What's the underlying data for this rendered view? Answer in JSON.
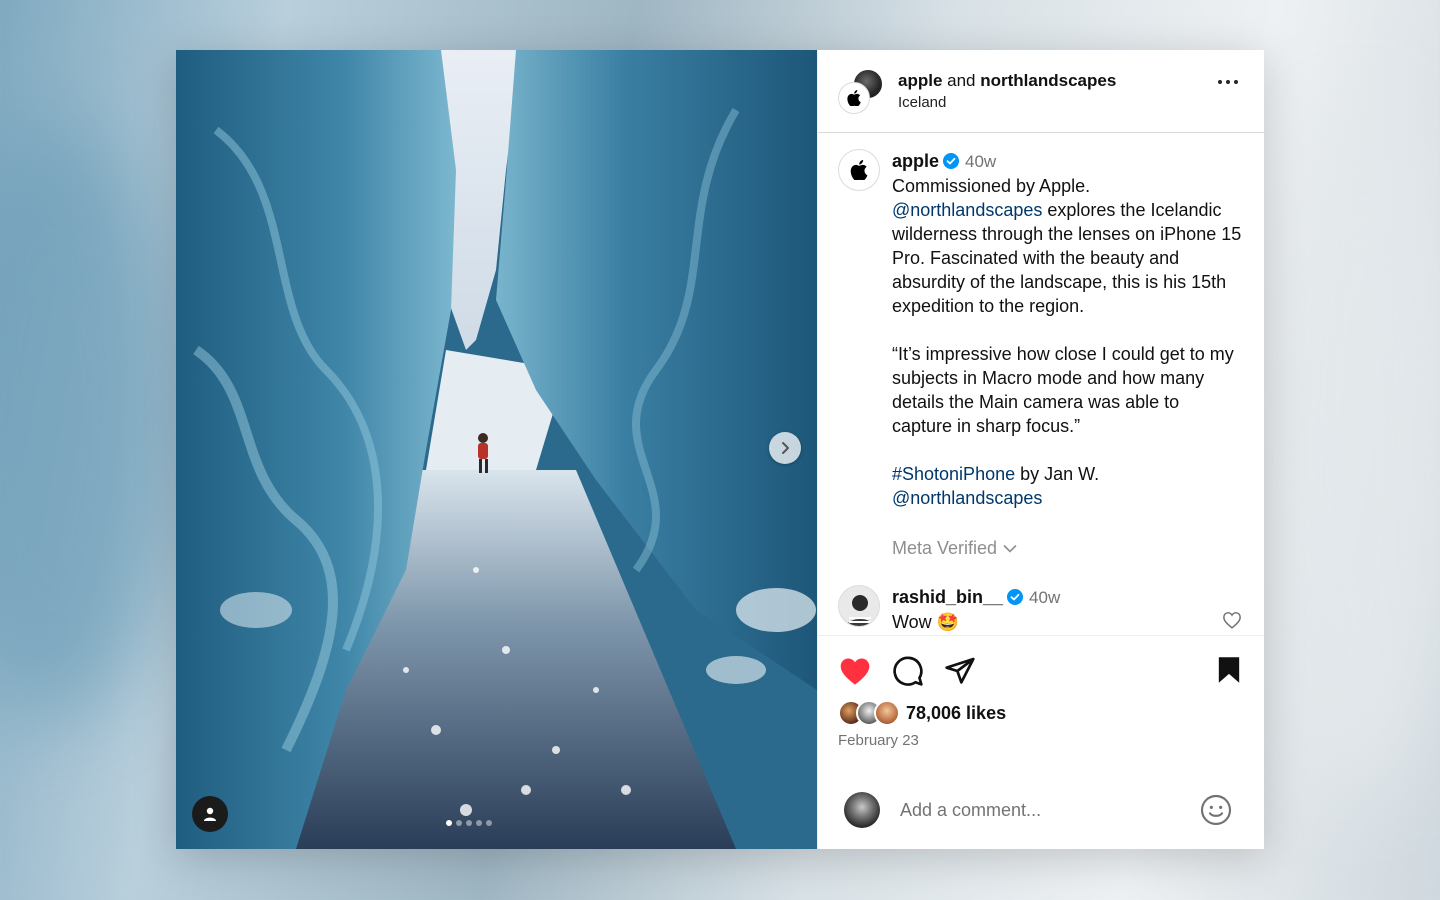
{
  "header": {
    "account_1": "apple",
    "joiner": "and",
    "account_2": "northlandscapes",
    "location": "Iceland"
  },
  "caption": {
    "username": "apple",
    "age": "40w",
    "line1": "Commissioned by Apple.",
    "mention1": "@northlandscapes",
    "para1_rest": "explores the Icelandic wilderness through the lenses on iPhone 15 Pro. Fascinated with the beauty and absurdity of the landscape, this is his 15th expedition to the region.",
    "quote": "“It’s impressive how close I could get to my subjects in Macro mode and how many details the Main camera was able to capture in sharp focus.”",
    "hashtag": "#ShotoniPhone",
    "credit": "by Jan W.",
    "mention2": "@northlandscapes",
    "meta_verified": "Meta Verified"
  },
  "comment": {
    "username": "rashid_bin__",
    "age": "40w",
    "text": "Wow 🤩"
  },
  "engagement": {
    "likes": "78,006 likes",
    "date": "February 23"
  },
  "add_comment": {
    "placeholder": "Add a comment..."
  },
  "carousel": {
    "slide_count": 5,
    "active_index": 0
  },
  "colors": {
    "like_red": "#ff3040",
    "verified_blue": "#0095f6",
    "link_blue": "#00376b"
  }
}
